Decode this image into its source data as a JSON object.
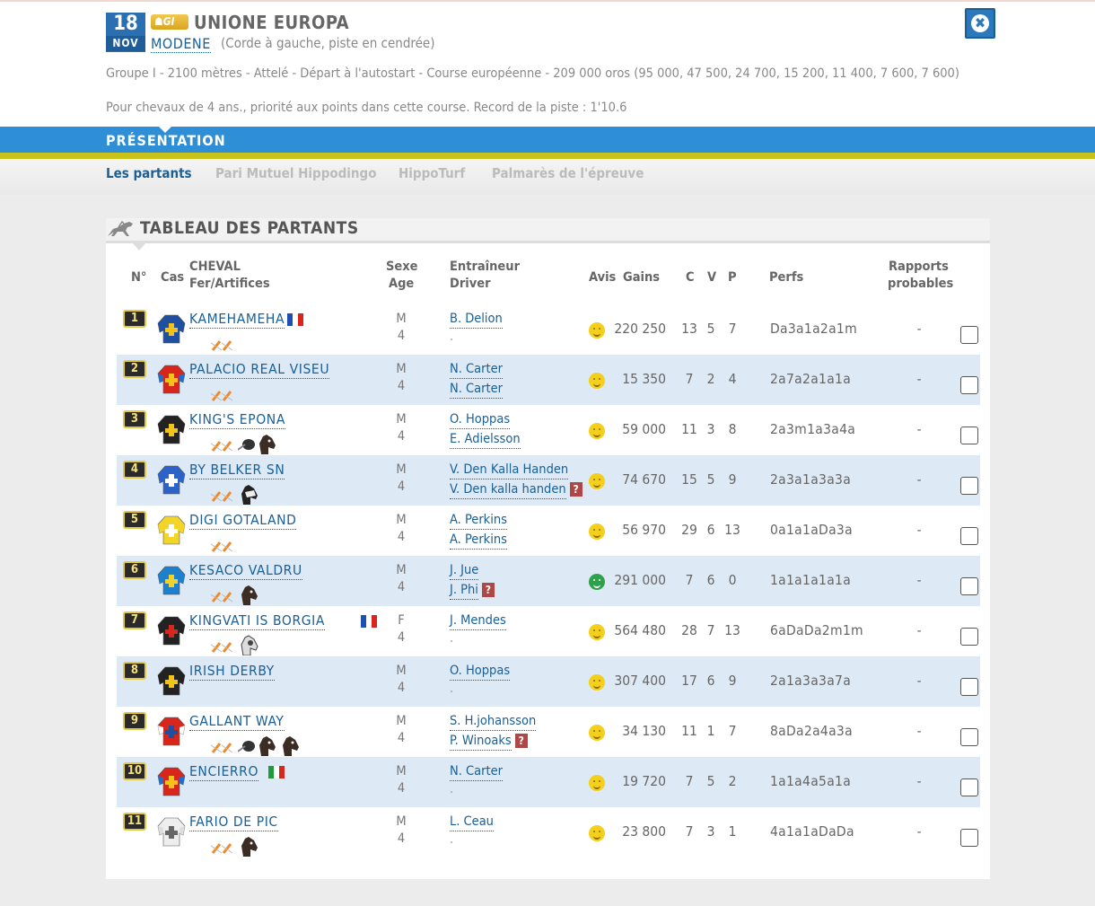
{
  "header": {
    "date_day": "18",
    "date_month": "NOV",
    "grade_badge": "GI",
    "race_title": "UNIONE EUROPA",
    "venue": "MODENE",
    "venue_detail": "(Corde à gauche, piste en cendrée)",
    "info_line1": "Groupe I - 2100 mètres - Attelé - Départ à l'autostart - Course européenne - 209 000 oros (95 000, 47 500, 24 700, 15 200, 11 400, 7 600, 7 600)",
    "info_line2": "Pour chevaux de 4 ans., priorité aux points dans cette course. Record de la piste : 1'10.6",
    "close_icon": "close-circle-icon"
  },
  "section_bar": {
    "label": "PRÉSENTATION"
  },
  "tabs": [
    {
      "label": "Les partants",
      "active": true
    },
    {
      "label": "Pari Mutuel Hippodingo",
      "active": false
    },
    {
      "label": "HippoTurf",
      "active": false
    },
    {
      "label": "Palmarès de l'épreuve",
      "active": false
    }
  ],
  "table": {
    "title": "TABLEAU DES PARTANTS",
    "headers": {
      "num": "N°",
      "cas": "Cas",
      "cheval": "CHEVAL",
      "fer": "Fer/Artifices",
      "sexe": "Sexe",
      "age": "Age",
      "entraineur": "Entraîneur",
      "driver": "Driver",
      "avis": "Avis",
      "gains": "Gains",
      "c": "C",
      "v": "V",
      "p": "P",
      "perfs": "Perfs",
      "rapports1": "Rapports",
      "rapports2": "probables"
    },
    "rows": [
      {
        "num": "1",
        "name": "KAMEHAMEHA",
        "flag": "fr",
        "sex": "M",
        "age": "4",
        "trainer": "B. Delion",
        "driver": ".",
        "driver_link": false,
        "q": false,
        "avis": "yellow",
        "gains": "220 250",
        "c": "13",
        "v": "5",
        "p": "7",
        "perfs": "Da3a1a2a1m",
        "rapport": "-",
        "jacket": "blue-yellow-cross",
        "artifices": [
          "shoe"
        ]
      },
      {
        "num": "2",
        "name": "PALACIO REAL VISEU",
        "flag": "",
        "sex": "M",
        "age": "4",
        "trainer": "N. Carter",
        "driver": "N. Carter",
        "driver_link": true,
        "q": false,
        "avis": "yellow",
        "gains": "15 350",
        "c": "7",
        "v": "2",
        "p": "4",
        "perfs": "2a7a2a1a1a",
        "rapport": "-",
        "jacket": "red-yellow",
        "artifices": [
          "shoe"
        ]
      },
      {
        "num": "3",
        "name": "KING'S EPONA",
        "flag": "",
        "sex": "M",
        "age": "4",
        "trainer": "O. Hoppas",
        "driver": "E. Adielsson",
        "driver_link": true,
        "q": false,
        "avis": "yellow",
        "gains": "59 000",
        "c": "11",
        "v": "3",
        "p": "8",
        "perfs": "2a3m1a3a4a",
        "rapport": "-",
        "jacket": "black-yellow-cross",
        "artifices": [
          "shoe",
          "bit",
          "head"
        ]
      },
      {
        "num": "4",
        "name": "BY BELKER SN",
        "flag": "",
        "sex": "M",
        "age": "4",
        "trainer": "V. Den Kalla Handen",
        "driver": "V. Den kalla handen",
        "driver_link": true,
        "q": true,
        "avis": "yellow",
        "gains": "74 670",
        "c": "15",
        "v": "5",
        "p": "9",
        "perfs": "2a3a1a3a3a",
        "rapport": "-",
        "jacket": "blue-check",
        "artifices": [
          "shoe",
          "hood"
        ]
      },
      {
        "num": "5",
        "name": "DIGI GOTALAND",
        "flag": "",
        "sex": "M",
        "age": "4",
        "trainer": "A. Perkins",
        "driver": "A. Perkins",
        "driver_link": true,
        "q": false,
        "avis": "yellow",
        "gains": "56 970",
        "c": "29",
        "v": "6",
        "p": "13",
        "perfs": "0a1a1aDa3a",
        "rapport": "-",
        "jacket": "yellow-white-stripe",
        "artifices": [
          "shoe"
        ]
      },
      {
        "num": "6",
        "name": "KESACO VALDRU",
        "flag": "",
        "sex": "M",
        "age": "4",
        "trainer": "J. Jue",
        "driver": "J. Phi",
        "driver_link": true,
        "q": true,
        "avis": "green",
        "gains": "291 000",
        "c": "7",
        "v": "6",
        "p": "0",
        "perfs": "1a1a1a1a1a",
        "rapport": "-",
        "jacket": "blue-yellow-stripe",
        "artifices": [
          "shoe",
          "head"
        ]
      },
      {
        "num": "7",
        "name": "KINGVATI IS BORGIA",
        "flag": "fr",
        "sex": "F",
        "age": "4",
        "trainer": "J. Mendes",
        "driver": ".",
        "driver_link": false,
        "q": false,
        "avis": "yellow",
        "gains": "564 480",
        "c": "28",
        "v": "7",
        "p": "13",
        "perfs": "6aDaDa2m1m",
        "rapport": "-",
        "jacket": "black-red-cross",
        "artifices": [
          "shoe",
          "hood2"
        ]
      },
      {
        "num": "8",
        "name": "IRISH DERBY",
        "flag": "",
        "sex": "M",
        "age": "4",
        "trainer": "O. Hoppas",
        "driver": ".",
        "driver_link": false,
        "q": false,
        "avis": "yellow",
        "gains": "307 400",
        "c": "17",
        "v": "6",
        "p": "9",
        "perfs": "2a1a3a3a7a",
        "rapport": "-",
        "jacket": "black-yellow-cross",
        "artifices": []
      },
      {
        "num": "9",
        "name": "GALLANT WAY",
        "flag": "",
        "sex": "M",
        "age": "4",
        "trainer": "S. H.johansson",
        "driver": "P. Winoaks",
        "driver_link": true,
        "q": true,
        "avis": "yellow",
        "gains": "34 130",
        "c": "11",
        "v": "1",
        "p": "7",
        "perfs": "8aDa2a4a3a",
        "rapport": "-",
        "jacket": "red-blue-white",
        "artifices": [
          "shoe",
          "bit",
          "head",
          "head"
        ]
      },
      {
        "num": "10",
        "name": "ENCIERRO",
        "flag": "it",
        "sex": "M",
        "age": "4",
        "trainer": "N. Carter",
        "driver": ".",
        "driver_link": false,
        "q": false,
        "avis": "yellow",
        "gains": "19 720",
        "c": "7",
        "v": "5",
        "p": "2",
        "perfs": "1a1a4a5a1a",
        "rapport": "-",
        "jacket": "red-yellow",
        "artifices": []
      },
      {
        "num": "11",
        "name": "FARIO DE PIC",
        "flag": "",
        "sex": "M",
        "age": "4",
        "trainer": "L. Ceau",
        "driver": ".",
        "driver_link": false,
        "q": false,
        "avis": "yellow",
        "gains": "23 800",
        "c": "7",
        "v": "3",
        "p": "1",
        "perfs": "4a1a1aDaDa",
        "rapport": "-",
        "jacket": "grey-stripe",
        "artifices": [
          "shoe",
          "head"
        ]
      }
    ]
  },
  "colors": {
    "accent_blue": "#2e8fd6",
    "link_blue": "#1a5f96",
    "yellow_bar": "#c9c21a",
    "row_alt": "#dde9f5"
  }
}
